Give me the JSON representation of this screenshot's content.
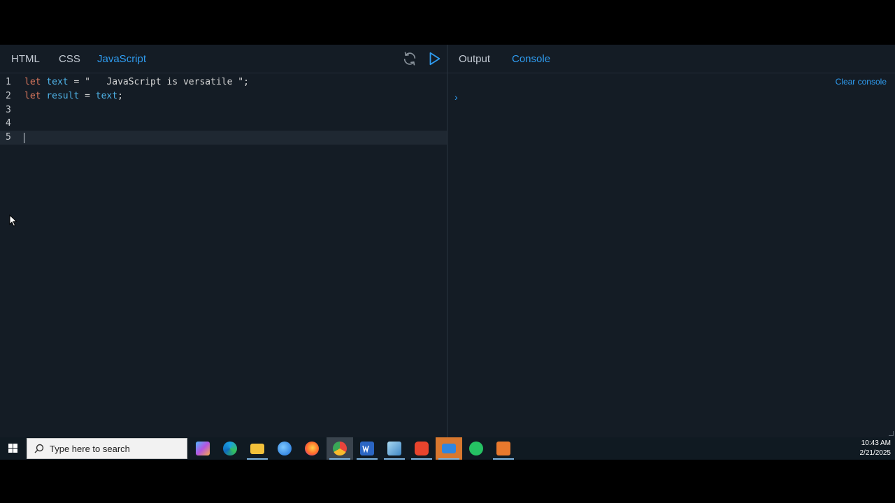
{
  "editor_tabs": [
    "HTML",
    "CSS",
    "JavaScript"
  ],
  "active_editor_tab": "JavaScript",
  "toolbar": {
    "refresh_icon": "refresh-icon",
    "run_icon": "play-icon"
  },
  "output_tabs": [
    "Output",
    "Console"
  ],
  "active_output_tab": "Console",
  "editor": {
    "line_numbers": [
      "1",
      "2",
      "3",
      "4",
      "5"
    ],
    "lines": [
      {
        "kw": "let",
        "var": "text",
        "rest": " = \"   JavaScript is versatile \";"
      },
      {
        "kw": "let",
        "var": "result",
        "rest": " = ",
        "var2": "text",
        "rest2": ";"
      }
    ],
    "current_line": 5
  },
  "console": {
    "clear_label": "Clear console",
    "prompt_symbol": "›"
  },
  "taskbar": {
    "search_placeholder": "Type here to search",
    "apps": [
      "Microsoft 365",
      "Edge",
      "File Explorer",
      "Thunderbird",
      "Firefox",
      "Chrome",
      "Word",
      "Notepad",
      "Brave",
      "Mail",
      "WhatsApp",
      "Presentation app"
    ],
    "time": "10:43 AM",
    "date": "2/21/2025"
  },
  "colors": {
    "accent": "#2f9cf0",
    "keyword": "#e07a5f",
    "variable": "#4fb3e8",
    "background": "#141c25"
  }
}
